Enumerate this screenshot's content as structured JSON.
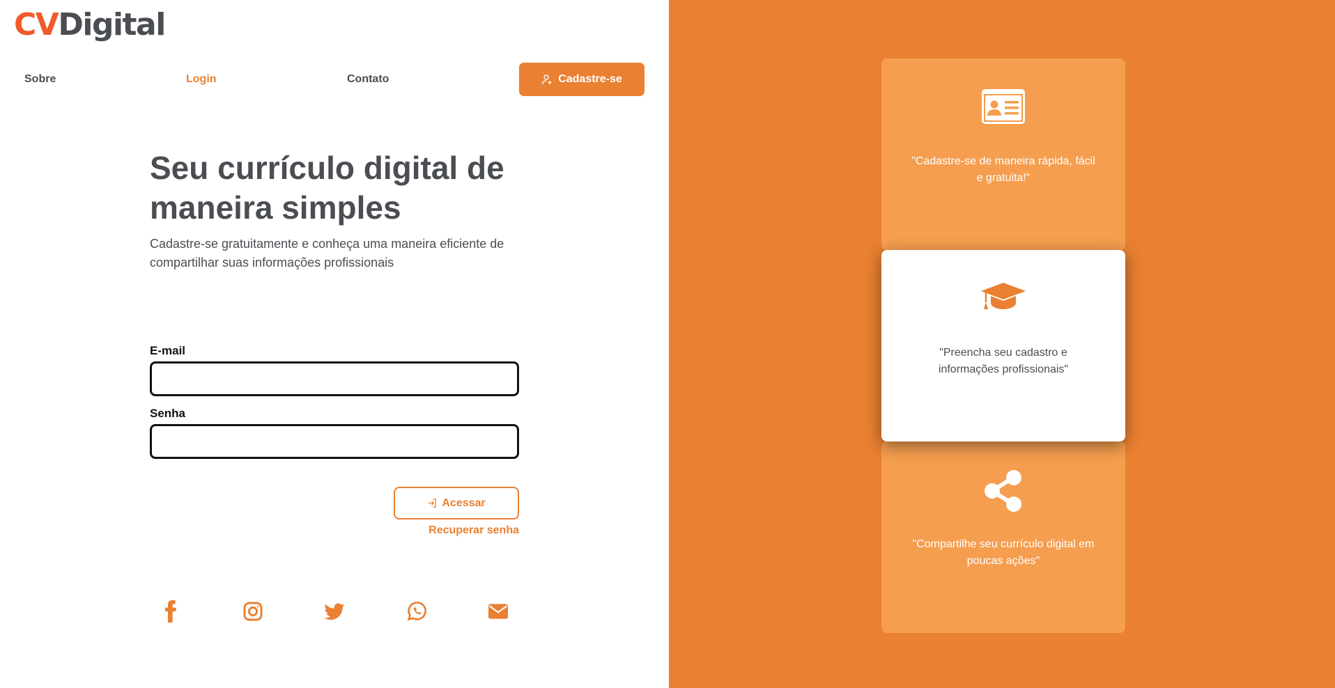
{
  "logo": {
    "part1": "CV",
    "part2": "Digital"
  },
  "nav": {
    "items": [
      {
        "label": "Sobre"
      },
      {
        "label": "Login"
      },
      {
        "label": "Contato"
      }
    ],
    "signup_label": "Cadastre-se"
  },
  "hero": {
    "title": "Seu currículo digital de maneira simples",
    "subtitle": "Cadastre-se gratuitamente e conheça uma maneira eficiente de compartilhar suas informações profissionais"
  },
  "form": {
    "email_label": "E-mail",
    "email_value": "",
    "password_label": "Senha",
    "password_value": "",
    "access_label": "Acessar",
    "recover_label": "Recuperar senha"
  },
  "social": {
    "icons": [
      "facebook-icon",
      "instagram-icon",
      "twitter-icon",
      "whatsapp-icon",
      "email-icon"
    ]
  },
  "cards": [
    {
      "icon": "id-card-icon",
      "text": "\"Cadastre-se de maneira rápida, fácil e gratuita!\""
    },
    {
      "icon": "graduation-cap-icon",
      "text": "\"Preencha seu cadastro e informações profissionais\""
    },
    {
      "icon": "share-icon",
      "text": "\"Compartilhe seu currículo digital em poucas ações\""
    }
  ],
  "colors": {
    "accent": "#ea8031",
    "card": "#f59e4f",
    "logo_cv": "#f15a2b",
    "text_dark": "#4a4d52"
  }
}
